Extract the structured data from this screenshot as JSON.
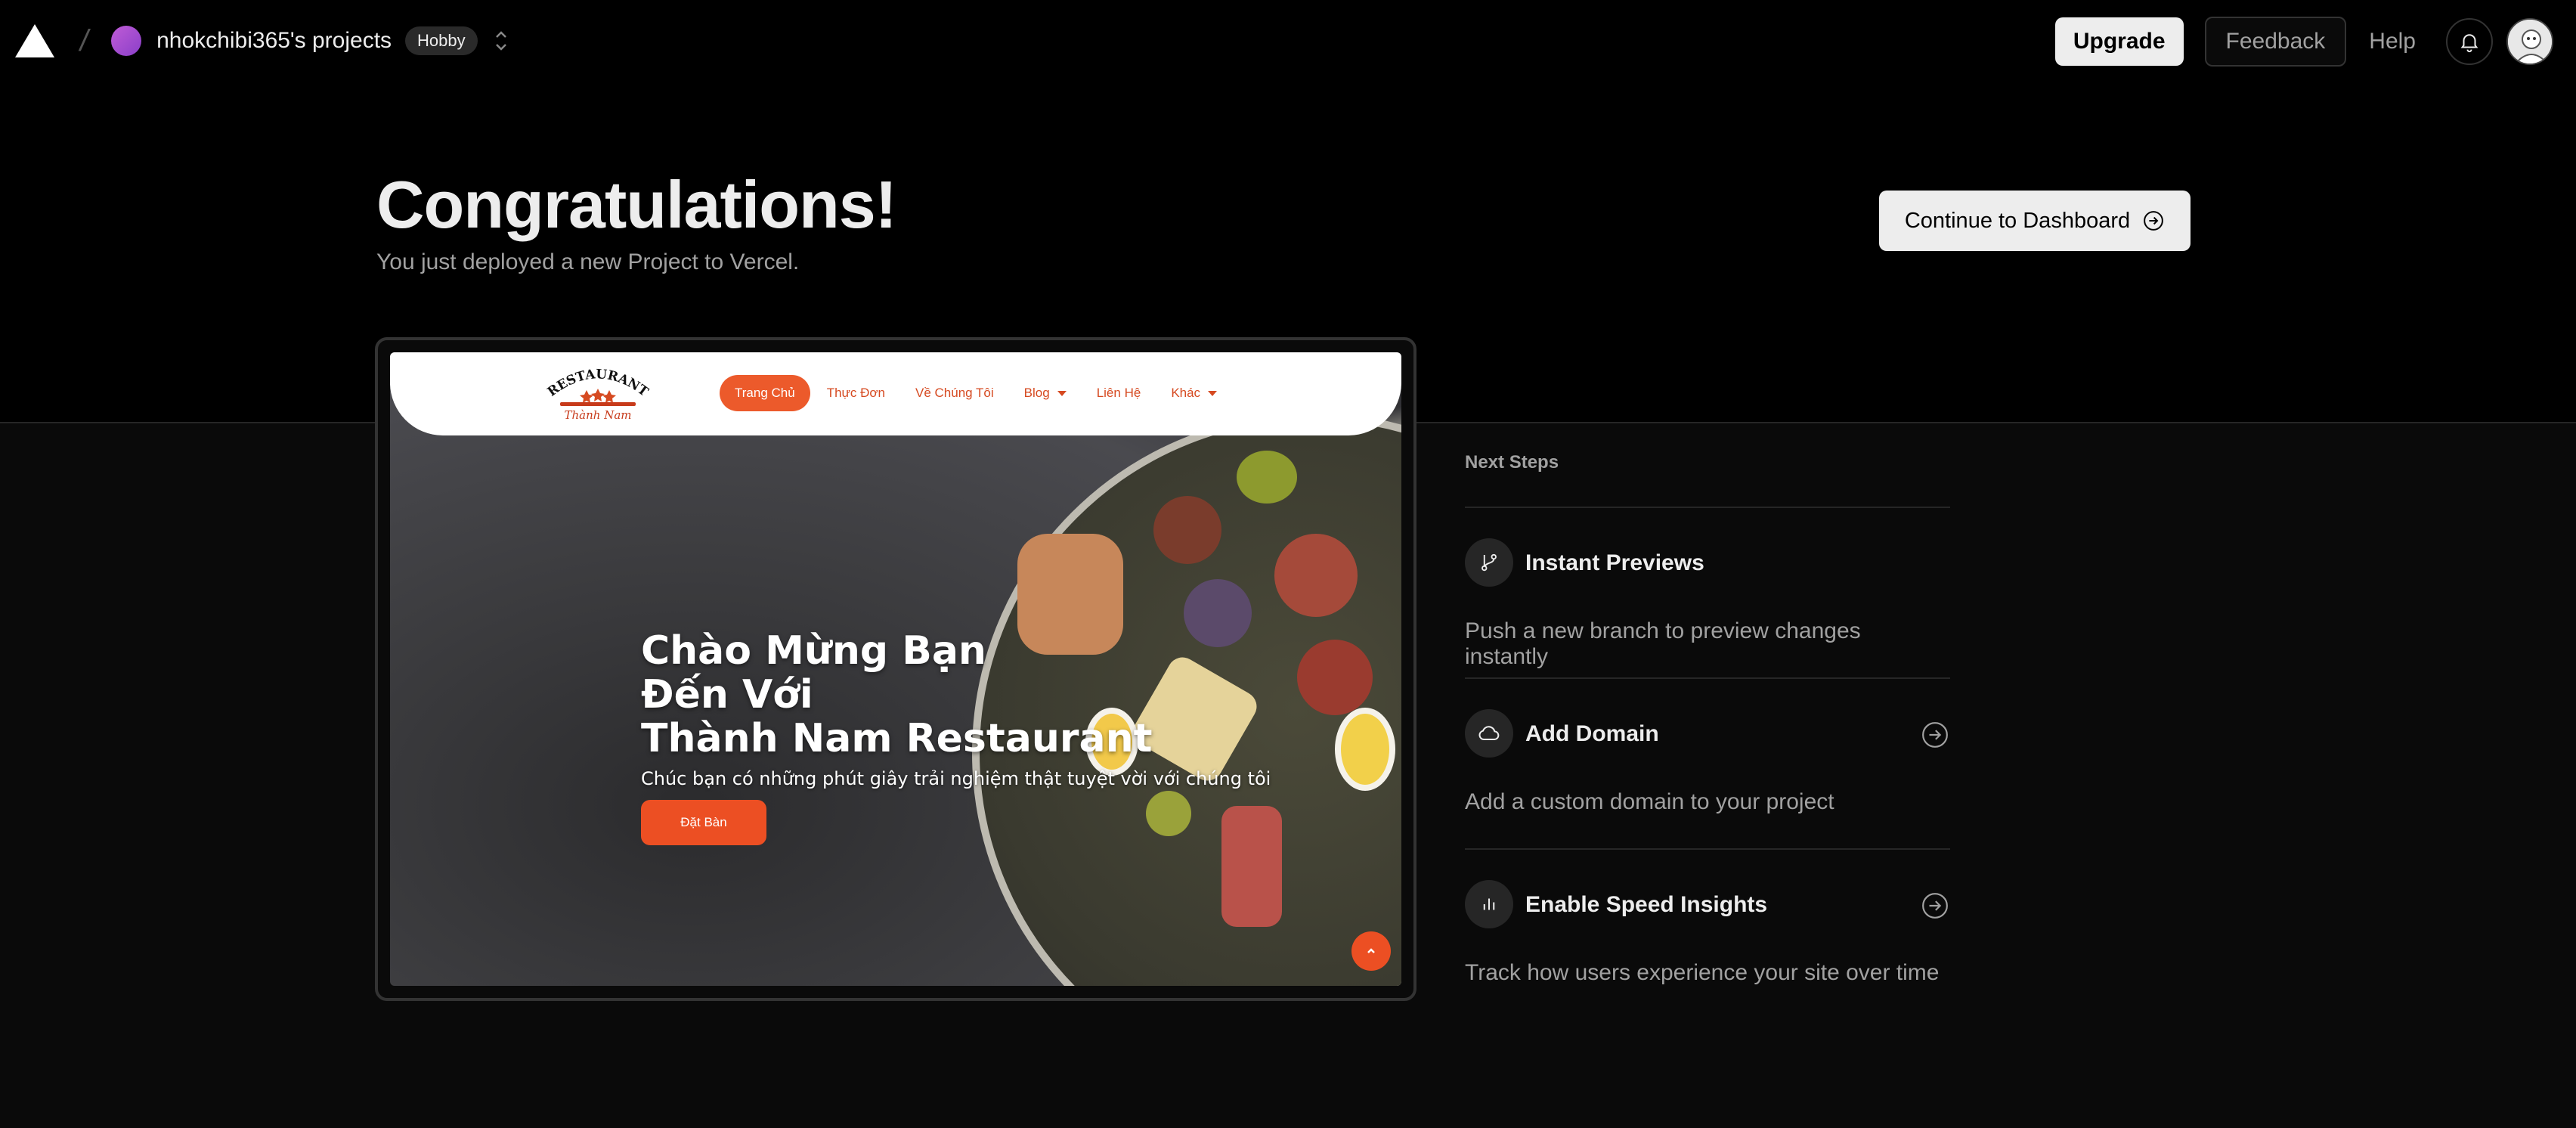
{
  "topbar": {
    "team_name": "nhokchibi365's projects",
    "plan": "Hobby",
    "upgrade_label": "Upgrade",
    "feedback_label": "Feedback",
    "help_label": "Help"
  },
  "hero": {
    "title": "Congratulations!",
    "subtitle": "You just deployed a new Project to Vercel.",
    "continue_label": "Continue to Dashboard"
  },
  "preview": {
    "logo_text_top": "RESTAURANT",
    "logo_text_bottom": "Thành Nam",
    "nav": [
      {
        "label": "Trang Chủ",
        "active": true
      },
      {
        "label": "Thực Đơn"
      },
      {
        "label": "Về Chúng Tôi"
      },
      {
        "label": "Blog",
        "dropdown": true
      },
      {
        "label": "Liên Hệ"
      },
      {
        "label": "Khác",
        "dropdown": true
      }
    ],
    "headline_lines": [
      "Chào Mừng Bạn",
      "Đến Với",
      "Thành Nam Restaurant"
    ],
    "tagline": "Chúc bạn có những phút giây trải nghiệm thật tuyệt vời với chúng tôi",
    "book_label": "Đặt Bàn",
    "accent_color": "#ec4f23"
  },
  "next_steps": {
    "heading": "Next Steps",
    "items": [
      {
        "title": "Instant Previews",
        "description": "Push a new branch to preview changes instantly",
        "icon": "git-branch-icon",
        "has_arrow": false
      },
      {
        "title": "Add Domain",
        "description": "Add a custom domain to your project",
        "icon": "cloud-icon",
        "has_arrow": true
      },
      {
        "title": "Enable Speed Insights",
        "description": "Track how users experience your site over time",
        "icon": "bar-chart-icon",
        "has_arrow": true
      }
    ]
  }
}
